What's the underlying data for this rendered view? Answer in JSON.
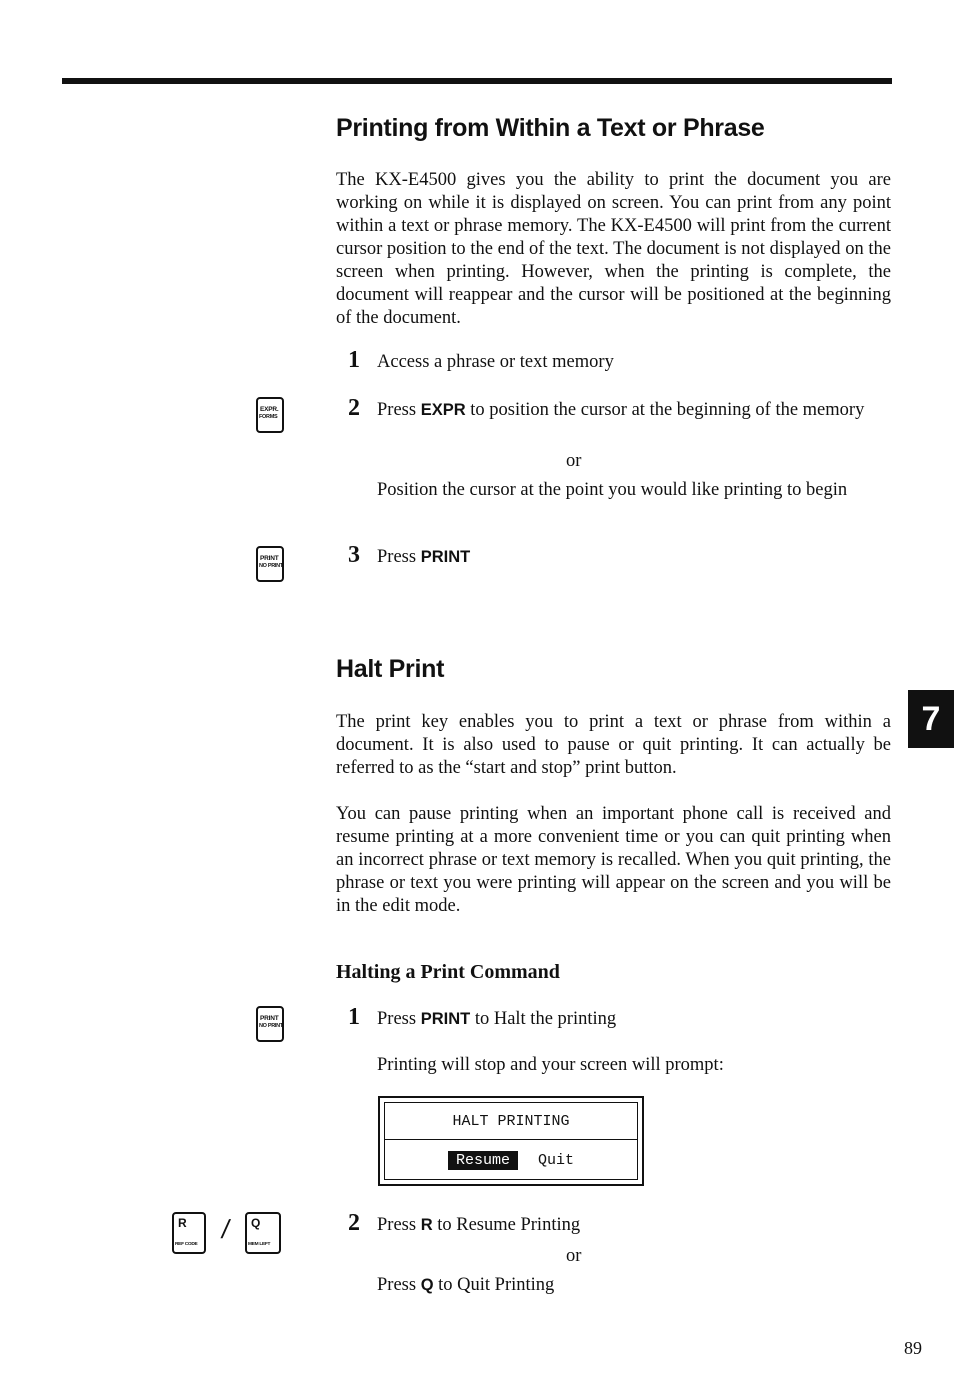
{
  "page_number": "89",
  "chapter_tab": "7",
  "section1": {
    "title": "Printing from Within a Text or Phrase",
    "intro": "The KX-E4500 gives you the ability to print the document you are working on while it is displayed on screen. You can print from any point within a text or phrase memory. The KX-E4500 will print from the current cursor position to the end of the text. The document is not displayed on the screen when printing. However, when the printing is complete, the document will reappear and the cursor will be positioned at the beginning of the document.",
    "steps": [
      {
        "num": "1",
        "text": "Access a phrase or text memory"
      },
      {
        "num": "2",
        "pre": "Press",
        "key": "EXPR",
        "post": "to position the cursor at the beginning of the memory",
        "or": "or",
        "alt": "Position the cursor at the point you would like printing to begin"
      },
      {
        "num": "3",
        "pre": "Press",
        "key": "PRINT"
      }
    ],
    "keys": {
      "expr": {
        "top": "EXPR.",
        "bottom": "FORMS"
      },
      "print": {
        "top": "PRINT",
        "bottom": "NO PRINT"
      }
    }
  },
  "section2": {
    "title": "Halt Print",
    "para1": "The print key enables you to print a text or phrase from within a document. It is also used to pause or quit printing. It can actually be referred to as the “start and stop” print button.",
    "para2": "You can pause printing when an important phone call is received and resume printing at a more convenient time or you can quit printing when an incorrect phrase or text memory is recalled. When you quit printing, the phrase or text you were printing will appear on the screen and you will be in the edit mode."
  },
  "section3": {
    "title": "Halting a Print Command",
    "step1": {
      "num": "1",
      "pre": "Press",
      "key": "PRINT",
      "post": "to Halt the printing"
    },
    "prompt_intro": "Printing will stop and your screen will prompt:",
    "dialog": {
      "title": "HALT PRINTING",
      "options": [
        "Resume",
        "Quit"
      ],
      "selected": "Resume"
    },
    "step2": {
      "num": "2",
      "pre": "Press",
      "key": "R",
      "post": "to Resume Printing",
      "or": "or",
      "alt_pre": "Press",
      "alt_key": "Q",
      "alt_post": "to Quit Printing"
    },
    "keys": {
      "print": {
        "top": "PRINT",
        "bottom": "NO PRINT"
      },
      "r": {
        "big": "R",
        "small": "REF CODE"
      },
      "q": {
        "big": "Q",
        "small": "MEM LEFT"
      },
      "separator": "/"
    }
  }
}
